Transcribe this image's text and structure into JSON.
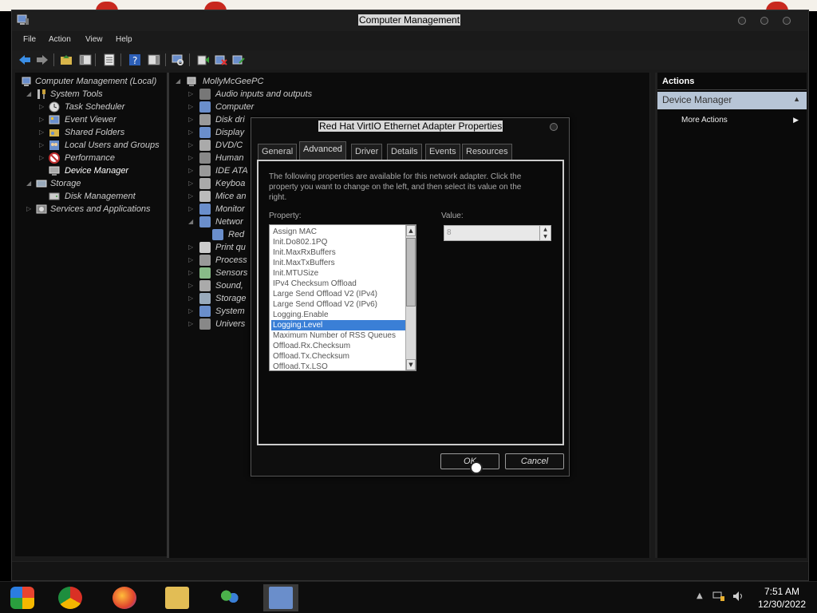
{
  "window": {
    "title": "Computer Management"
  },
  "menu": [
    "File",
    "Action",
    "View",
    "Help"
  ],
  "tree": {
    "root": "Computer Management (Local)",
    "items": [
      {
        "label": "System Tools"
      },
      {
        "label": "Task Scheduler"
      },
      {
        "label": "Event Viewer"
      },
      {
        "label": "Shared Folders"
      },
      {
        "label": "Local Users and Groups"
      },
      {
        "label": "Performance"
      },
      {
        "label": "Device Manager"
      },
      {
        "label": "Storage"
      },
      {
        "label": "Disk Management"
      },
      {
        "label": "Services and Applications"
      }
    ]
  },
  "devices": {
    "computer_name": "MollyMcGeePC",
    "items": [
      {
        "label": "Audio inputs and outputs"
      },
      {
        "label": "Computer"
      },
      {
        "label": "Disk dri"
      },
      {
        "label": "Display"
      },
      {
        "label": "DVD/C"
      },
      {
        "label": "Human"
      },
      {
        "label": "IDE ATA"
      },
      {
        "label": "Keyboa"
      },
      {
        "label": "Mice an"
      },
      {
        "label": "Monitor"
      },
      {
        "label": "Networ"
      },
      {
        "label": "Red"
      },
      {
        "label": "Print qu"
      },
      {
        "label": "Process"
      },
      {
        "label": "Sensors"
      },
      {
        "label": "Sound,"
      },
      {
        "label": "Storage"
      },
      {
        "label": "System"
      },
      {
        "label": "Univers"
      }
    ]
  },
  "actions": {
    "header": "Actions",
    "section": "Device Manager",
    "more": "More Actions"
  },
  "dialog": {
    "title": "Red Hat VirtIO Ethernet Adapter Properties",
    "tabs": [
      "General",
      "Advanced",
      "Driver",
      "Details",
      "Events",
      "Resources"
    ],
    "active_tab": "Advanced",
    "description": "The following properties are available for this network adapter. Click the property you want to change on the left, and then select its value on the right.",
    "property_label": "Property:",
    "value_label": "Value:",
    "properties": [
      "Assign MAC",
      "Init.Do802.1PQ",
      "Init.MaxRxBuffers",
      "Init.MaxTxBuffers",
      "Init.MTUSize",
      "IPv4 Checksum Offload",
      "Large Send Offload V2 (IPv4)",
      "Large Send Offload V2 (IPv6)",
      "Logging.Enable",
      "Logging.Level",
      "Maximum Number of RSS Queues",
      "Offload.Rx.Checksum",
      "Offload.Tx.Checksum",
      "Offload.Tx.LSO"
    ],
    "selected_property": "Logging.Level",
    "value": "8",
    "ok": "OK",
    "cancel": "Cancel"
  },
  "taskbar": {
    "apps": [
      "windows-start",
      "chrome",
      "firefox",
      "file-explorer",
      "people",
      "computer-management"
    ],
    "time": "7:51 AM",
    "date": "12/30/2022"
  }
}
